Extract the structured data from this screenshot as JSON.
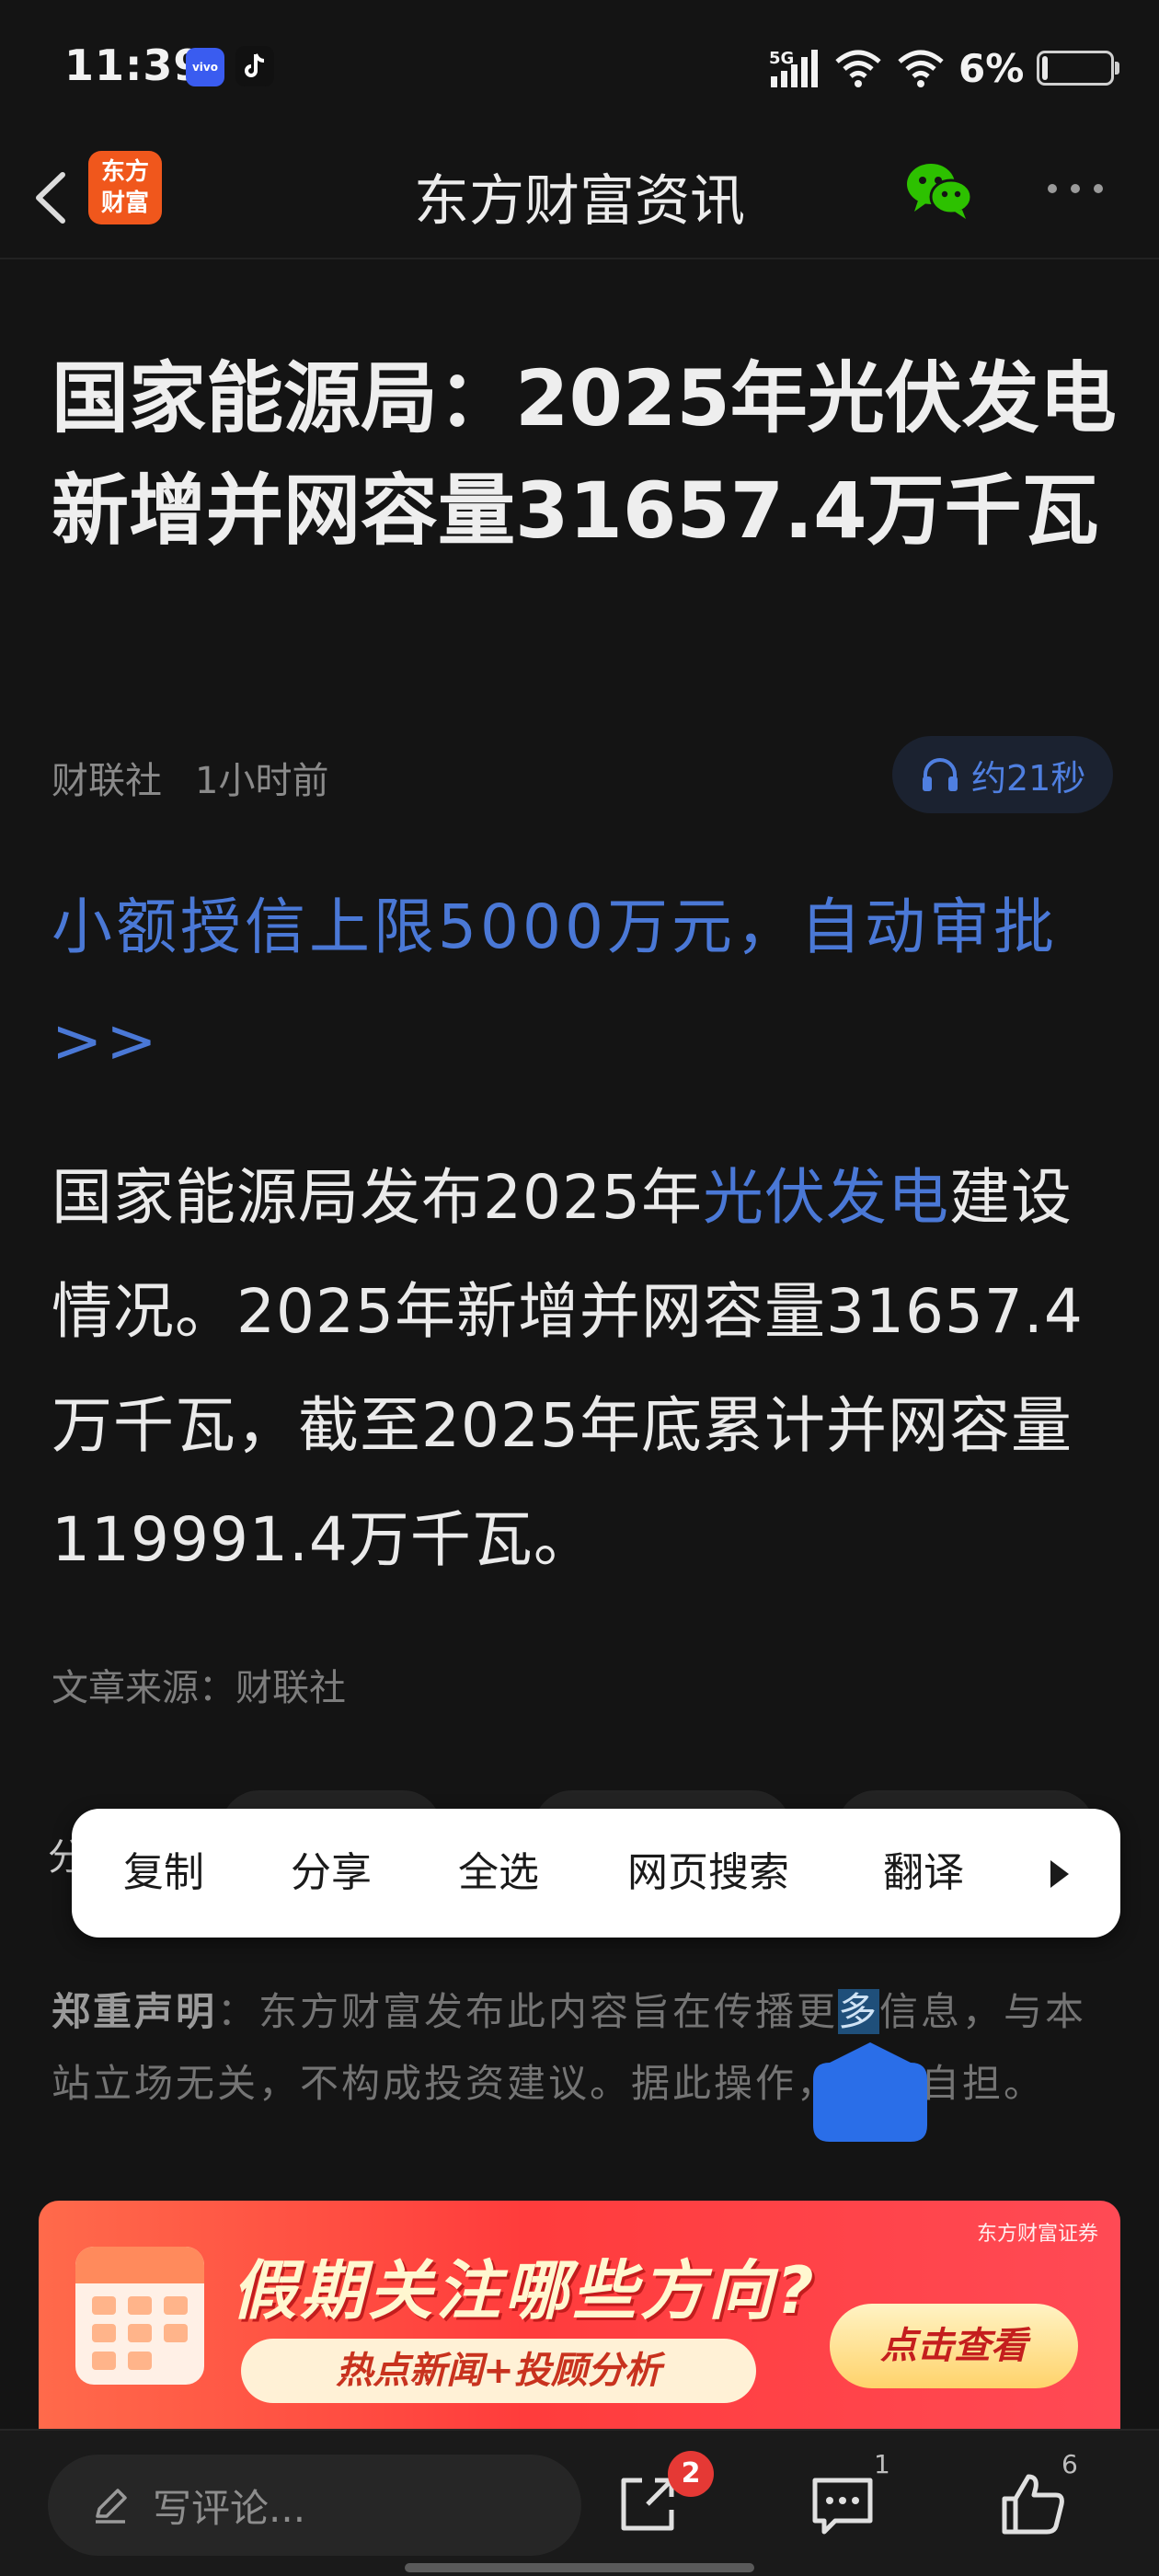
{
  "status_bar": {
    "time": "11:39",
    "vivo_label": "vivo",
    "network": "5G",
    "battery": "6%"
  },
  "nav": {
    "logo_text": "东方\n财富",
    "title": "东方财富资讯"
  },
  "article": {
    "headline": "国家能源局：2025年光伏发电新增并网容量31657.4万千瓦",
    "source": "财联社",
    "time": "1小时前",
    "audio_label": "约21秒",
    "promo_link": "小额授信上限5000万元，自动审批 >>",
    "body_pre": "国家能源局发布2025年",
    "body_keyword": "光伏发电",
    "body_post": "建设情况。2025年新增并网容量31657.4万千瓦，截至2025年底累计并网容量119991.4万千瓦。",
    "source_line": "文章来源：财联社",
    "share_fragment": "分"
  },
  "context_menu": {
    "items": [
      "复制",
      "分享",
      "全选",
      "网页搜索",
      "翻译"
    ]
  },
  "disclaimer": {
    "label": "郑重声明",
    "text_pre": "：东方财富发布此内容旨在传播更",
    "selected": "多",
    "text_post": "信息，与本站立场无关，不构成投资建议。据此操作，风险自担。"
  },
  "banner": {
    "brand": "东方财富证券",
    "title": "假期关注哪些方向?",
    "subtitle": "热点新闻+投顾分析",
    "cta": "点击查看"
  },
  "bottom_bar": {
    "comment_placeholder": "写评论...",
    "share_badge": "2",
    "comment_count": "1",
    "like_count": "6"
  },
  "colors": {
    "background": "#141414",
    "link_blue": "#4a78d6",
    "badge_red": "#e53935",
    "wechat_green": "#2dc100"
  }
}
